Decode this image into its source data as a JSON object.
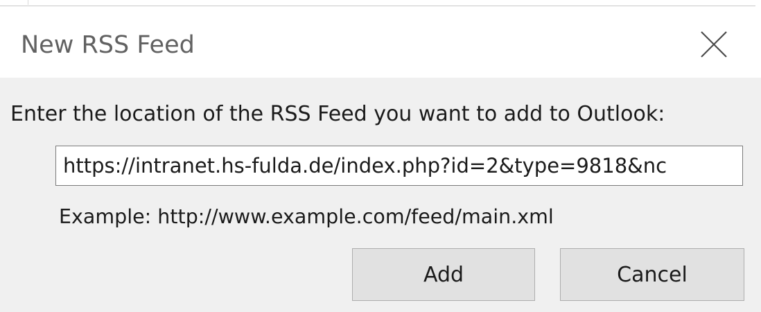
{
  "dialog": {
    "title": "New RSS Feed",
    "close_icon": "close-icon",
    "prompt": "Enter the location of the RSS Feed you want to add to Outlook:",
    "url_value": "https://intranet.hs-fulda.de/index.php?id=2&type=9818&nc",
    "example_text": "Example: http://www.example.com/feed/main.xml",
    "add_label": "Add",
    "cancel_label": "Cancel"
  }
}
